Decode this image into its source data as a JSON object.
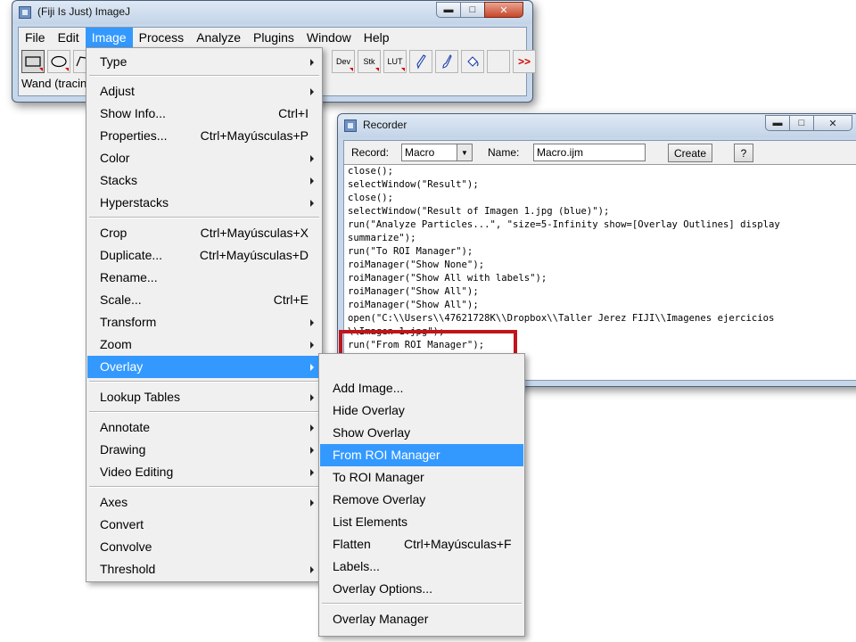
{
  "imagej": {
    "title": "(Fiji Is Just) ImageJ",
    "menus": [
      "File",
      "Edit",
      "Image",
      "Process",
      "Analyze",
      "Plugins",
      "Window",
      "Help"
    ],
    "tools": {
      "dev": "Dev",
      "stk": "Stk",
      "lut": "LUT",
      "more": ">>"
    },
    "status": "Wand (tracin"
  },
  "recorder": {
    "title": "Recorder",
    "record_label": "Record:",
    "record_value": "Macro",
    "name_label": "Name:",
    "name_value": "Macro.ijm",
    "create_label": "Create",
    "help_label": "?",
    "code_lines": [
      "close();",
      "selectWindow(\"Result\");",
      "close();",
      "selectWindow(\"Result of Imagen 1.jpg (blue)\");",
      "run(\"Analyze Particles...\", \"size=5-Infinity show=[Overlay Outlines] display",
      "summarize\");",
      "run(\"To ROI Manager\");",
      "roiManager(\"Show None\");",
      "roiManager(\"Show All with labels\");",
      "roiManager(\"Show All\");",
      "roiManager(\"Show All\");",
      "open(\"C:\\\\Users\\\\47621728K\\\\Dropbox\\\\Taller Jerez FIJI\\\\Imagenes ejercicios",
      "\\\\Imagen 1.jpg\");",
      "run(\"From ROI Manager\");"
    ]
  },
  "image_menu": {
    "items": [
      {
        "label": "Type",
        "shortcut": "",
        "submenu": true
      },
      {
        "label": "Adjust",
        "shortcut": "",
        "submenu": true
      },
      {
        "label": "Show Info...",
        "shortcut": "Ctrl+I",
        "submenu": false
      },
      {
        "label": "Properties...",
        "shortcut": "Ctrl+Mayúsculas+P",
        "submenu": false
      },
      {
        "label": "Color",
        "shortcut": "",
        "submenu": true
      },
      {
        "label": "Stacks",
        "shortcut": "",
        "submenu": true
      },
      {
        "label": "Hyperstacks",
        "shortcut": "",
        "submenu": true
      },
      {
        "label": "Crop",
        "shortcut": "Ctrl+Mayúsculas+X",
        "submenu": false
      },
      {
        "label": "Duplicate...",
        "shortcut": "Ctrl+Mayúsculas+D",
        "submenu": false
      },
      {
        "label": "Rename...",
        "shortcut": "",
        "submenu": false
      },
      {
        "label": "Scale...",
        "shortcut": "Ctrl+E",
        "submenu": false
      },
      {
        "label": "Transform",
        "shortcut": "",
        "submenu": true
      },
      {
        "label": "Zoom",
        "shortcut": "",
        "submenu": true
      },
      {
        "label": "Overlay",
        "shortcut": "",
        "submenu": true
      },
      {
        "label": "Lookup Tables",
        "shortcut": "",
        "submenu": true
      },
      {
        "label": "Annotate",
        "shortcut": "",
        "submenu": true
      },
      {
        "label": "Drawing",
        "shortcut": "",
        "submenu": true
      },
      {
        "label": "Video Editing",
        "shortcut": "",
        "submenu": true
      },
      {
        "label": "Axes",
        "shortcut": "",
        "submenu": true
      },
      {
        "label": "Convert",
        "shortcut": "",
        "submenu": false
      },
      {
        "label": "Convolve",
        "shortcut": "",
        "submenu": false
      },
      {
        "label": "Threshold",
        "shortcut": "",
        "submenu": true
      }
    ]
  },
  "overlay_menu": {
    "items": [
      {
        "label": "Add Image...",
        "shortcut": ""
      },
      {
        "label": "Hide Overlay",
        "shortcut": ""
      },
      {
        "label": "Show Overlay",
        "shortcut": ""
      },
      {
        "label": "From ROI Manager",
        "shortcut": ""
      },
      {
        "label": "To ROI Manager",
        "shortcut": ""
      },
      {
        "label": "Remove Overlay",
        "shortcut": ""
      },
      {
        "label": "List Elements",
        "shortcut": ""
      },
      {
        "label": "Flatten",
        "shortcut": "Ctrl+Mayúsculas+F"
      },
      {
        "label": "Labels...",
        "shortcut": ""
      },
      {
        "label": "Overlay Options...",
        "shortcut": ""
      },
      {
        "label": "Overlay Manager",
        "shortcut": ""
      }
    ]
  },
  "colors": {
    "highlight": "#3399ff",
    "annotation_box": "#c0151b"
  }
}
